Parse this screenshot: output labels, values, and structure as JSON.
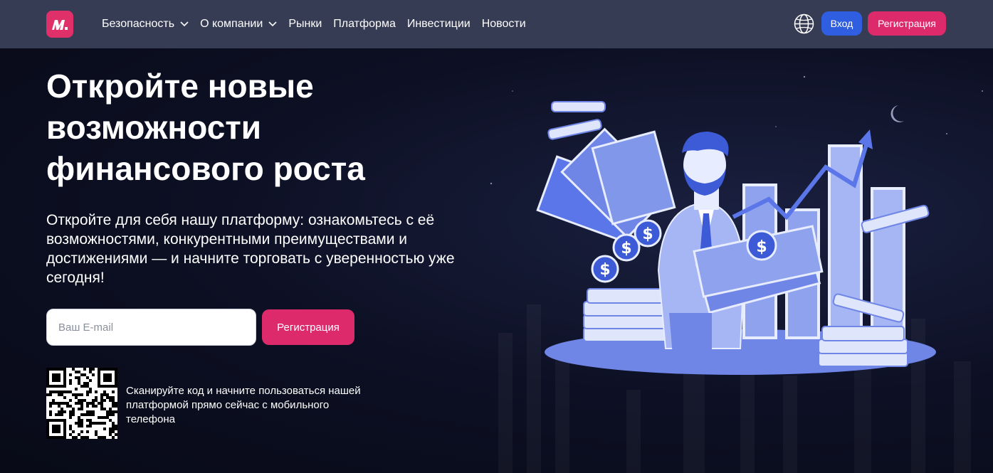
{
  "header": {
    "logo_alt": "logo",
    "nav": [
      {
        "label": "Безопасность",
        "dropdown": true
      },
      {
        "label": "О компании",
        "dropdown": true
      },
      {
        "label": "Рынки",
        "dropdown": false
      },
      {
        "label": "Платформа",
        "dropdown": false
      },
      {
        "label": "Инвестиции",
        "dropdown": false
      },
      {
        "label": "Новости",
        "dropdown": false
      }
    ],
    "login_label": "Вход",
    "register_label": "Регистрация"
  },
  "hero": {
    "title": "Откройте новые возможности финансового роста",
    "subtitle": "Откройте для себя нашу платформу: ознакомьтесь с её возможностями, конкурентными преимуществами и достижениями — и начните торговать с уверенностью уже сегодня!",
    "email_placeholder": "Ваш E-mail",
    "email_value": "",
    "register_label": "Регистрация",
    "qr_text": "Сканируйте код и начните пользоваться нашей платформой прямо сейчас с мобильного телефона"
  },
  "colors": {
    "header_bg": "#373c55",
    "accent_pink": "#dd2a6b",
    "accent_blue": "#2f5fe0",
    "illustration_blue": "#6f86e6"
  },
  "icons": {
    "logo": "m-logo-icon",
    "language": "globe-icon",
    "dropdown": "chevron-down-icon"
  }
}
